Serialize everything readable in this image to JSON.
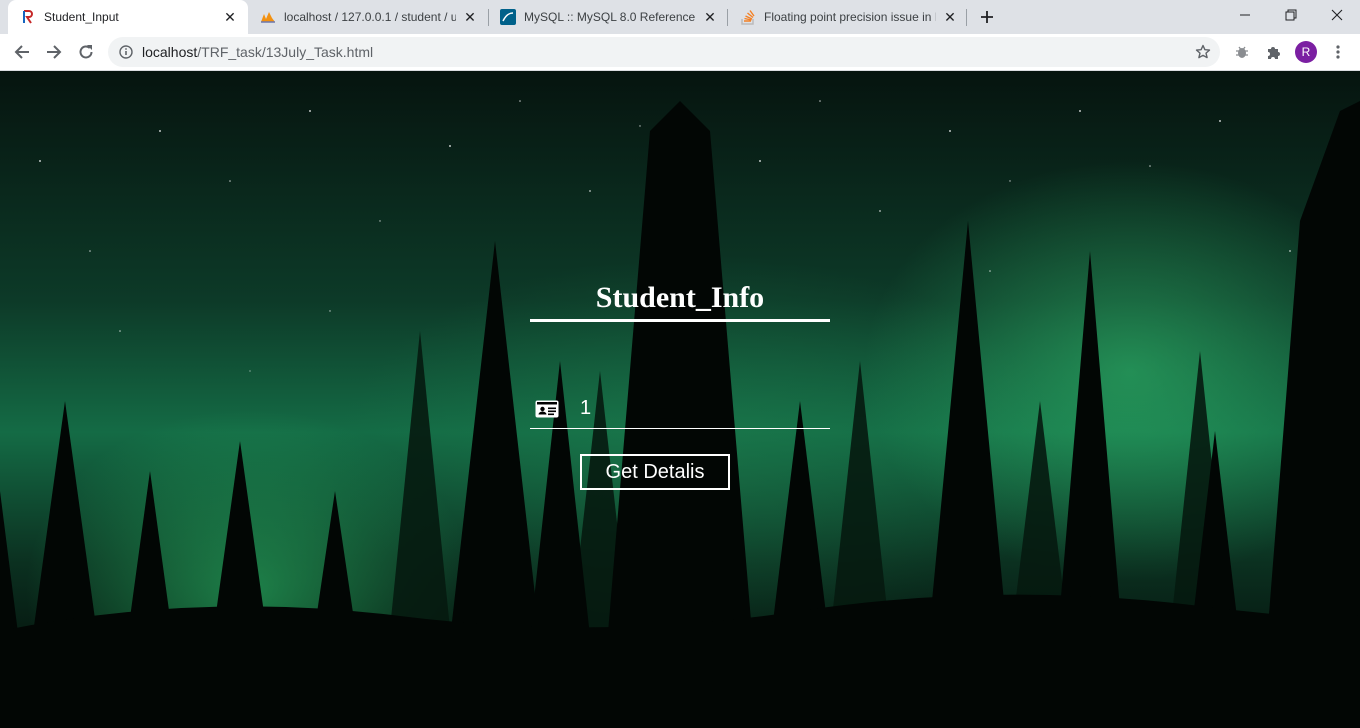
{
  "browser": {
    "tabs": [
      {
        "title": "Student_Input",
        "favicon": "r-app-icon",
        "active": true
      },
      {
        "title": "localhost / 127.0.0.1 / student / u",
        "favicon": "phpmyadmin-icon",
        "active": false
      },
      {
        "title": "MySQL :: MySQL 8.0 Reference M",
        "favicon": "mysql-icon",
        "active": false
      },
      {
        "title": "Floating point precision issue in I",
        "favicon": "stackoverflow-icon",
        "active": false
      }
    ],
    "address_bar": {
      "host": "localhost",
      "path": "/TRF_task/13July_Task.html"
    },
    "profile_initial": "R"
  },
  "page": {
    "heading": "Student_Info",
    "id_input": {
      "value": "1",
      "icon": "id-card-icon"
    },
    "submit_label": "Get Detalis"
  },
  "colors": {
    "tab_strip": "#dee1e6",
    "profile": "#7b1fa2",
    "aurora_green": "#2ec86e"
  }
}
